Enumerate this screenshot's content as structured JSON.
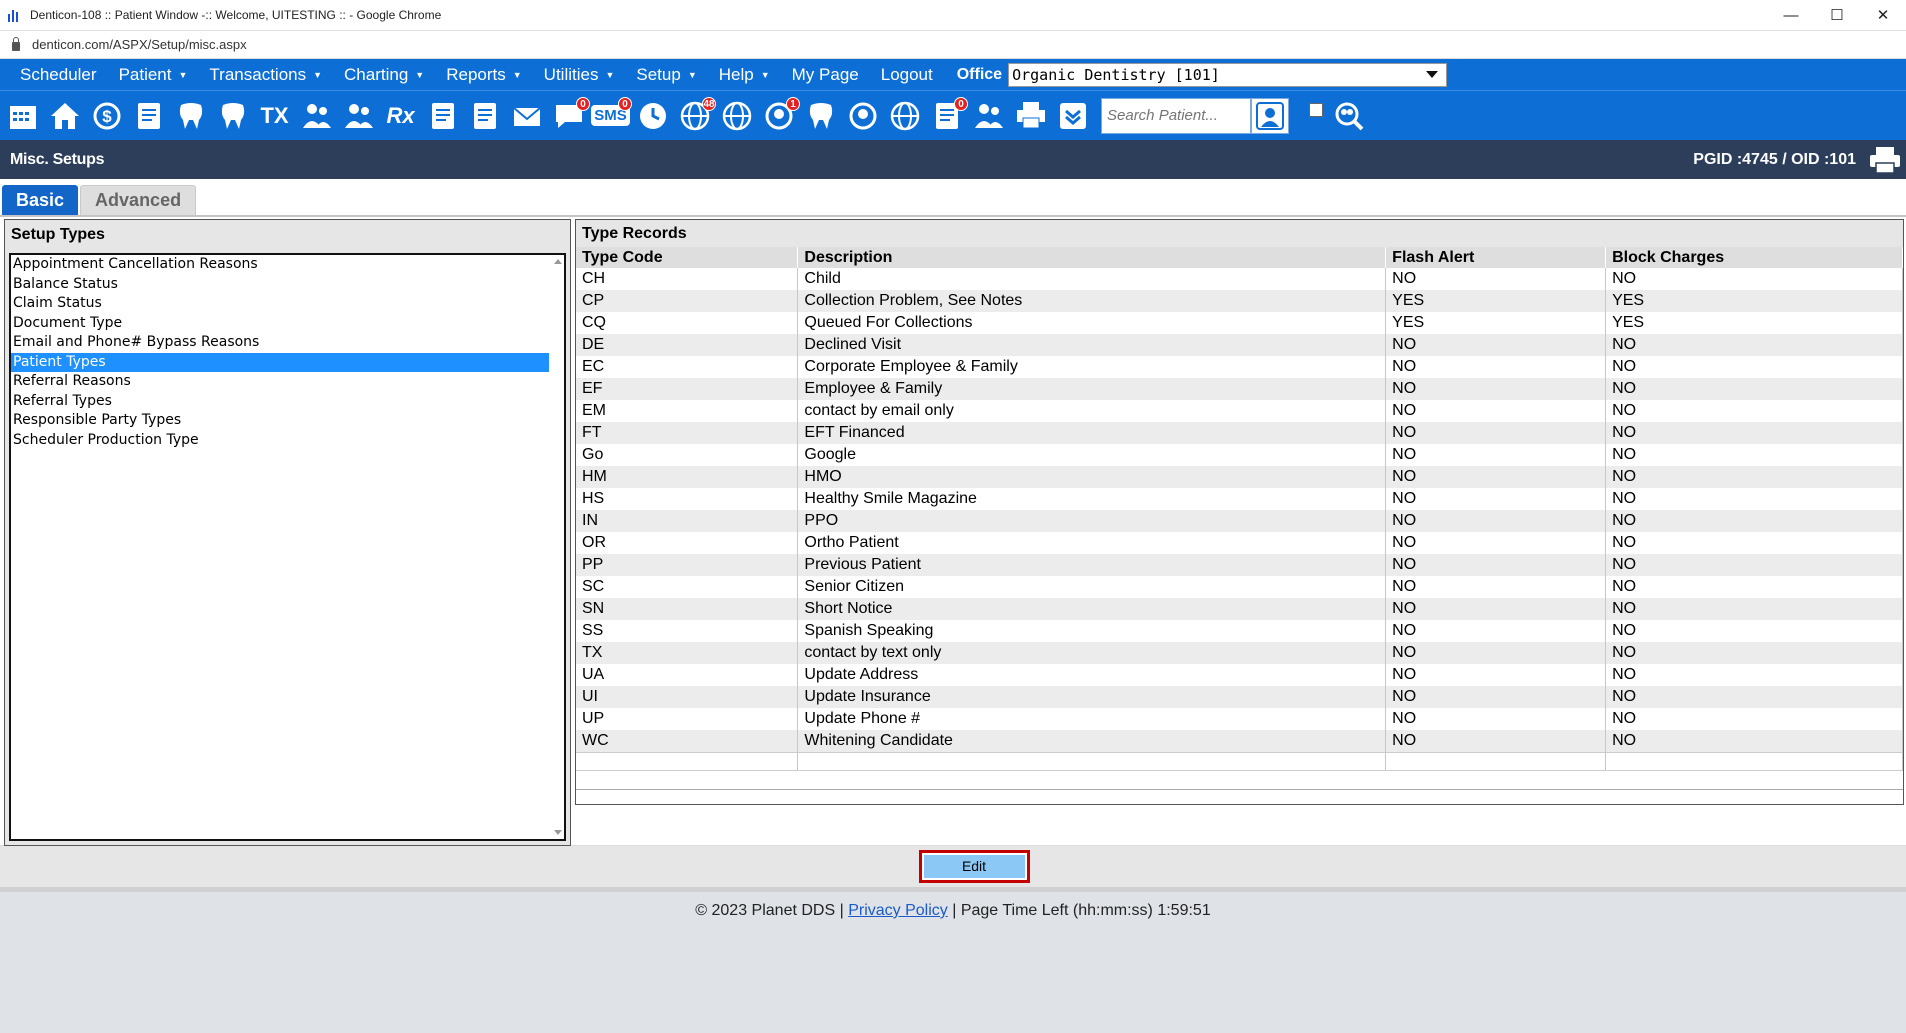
{
  "window": {
    "title": "Denticon-108 :: Patient Window -:: Welcome, UITESTING :: - Google Chrome"
  },
  "address": {
    "url": "denticon.com/ASPX/Setup/misc.aspx"
  },
  "menu": {
    "items": [
      {
        "label": "Scheduler",
        "caret": false
      },
      {
        "label": "Patient",
        "caret": true
      },
      {
        "label": "Transactions",
        "caret": true
      },
      {
        "label": "Charting",
        "caret": true
      },
      {
        "label": "Reports",
        "caret": true
      },
      {
        "label": "Utilities",
        "caret": true
      },
      {
        "label": "Setup",
        "caret": true
      },
      {
        "label": "Help",
        "caret": true
      },
      {
        "label": "My Page",
        "caret": false
      },
      {
        "label": "Logout",
        "caret": false
      }
    ],
    "office_label": "Office",
    "office_value": "Organic Dentistry [101]"
  },
  "toolbar": {
    "icons": [
      {
        "name": "calendar-icon"
      },
      {
        "name": "home-icon"
      },
      {
        "name": "dollar-sync-icon"
      },
      {
        "name": "pencil-chart-icon"
      },
      {
        "name": "tooth-chart-icon"
      },
      {
        "name": "tooth-implant-icon"
      },
      {
        "name": "treatment-icon",
        "text": "TX"
      },
      {
        "name": "add-patient-icon"
      },
      {
        "name": "family-add-icon"
      },
      {
        "name": "prescription-icon",
        "text": "Rx"
      },
      {
        "name": "notes-icon"
      },
      {
        "name": "document-icon"
      },
      {
        "name": "mail-icon"
      },
      {
        "name": "messages-icon",
        "badge": "0"
      },
      {
        "name": "sms-icon",
        "text": "SMS",
        "badge": "0"
      },
      {
        "name": "clock-icon"
      },
      {
        "name": "web-users-icon",
        "badge": "48"
      },
      {
        "name": "globe-users-icon"
      },
      {
        "name": "support-icon",
        "badge": "1"
      },
      {
        "name": "tooth-icon"
      },
      {
        "name": "tooth-help-icon"
      },
      {
        "name": "globe-network-icon"
      },
      {
        "name": "checklist-icon",
        "badge": "0"
      },
      {
        "name": "team-icon"
      },
      {
        "name": "printer-icon"
      },
      {
        "name": "download-icon"
      }
    ],
    "search_placeholder": "Search Patient..."
  },
  "header": {
    "title": "Misc. Setups",
    "pgid": "PGID :4745  /  OID :101"
  },
  "tabs": [
    {
      "label": "Basic",
      "active": true
    },
    {
      "label": "Advanced",
      "active": false
    }
  ],
  "setup_types": {
    "title": "Setup Types",
    "items": [
      "Appointment Cancellation Reasons",
      "Balance Status",
      "Claim Status",
      "Document Type",
      "Email and Phone# Bypass Reasons",
      "Patient Types",
      "Referral Reasons",
      "Referral Types",
      "Responsible Party Types",
      "Scheduler Production Type"
    ],
    "selected": "Patient Types"
  },
  "type_records": {
    "title": "Type Records",
    "columns": [
      "Type Code",
      "Description",
      "Flash Alert",
      "Block Charges"
    ],
    "rows": [
      [
        "CH",
        "Child",
        "NO",
        "NO"
      ],
      [
        "CP",
        "Collection Problem, See Notes",
        "YES",
        "YES"
      ],
      [
        "CQ",
        "Queued For Collections",
        "YES",
        "YES"
      ],
      [
        "DE",
        "Declined Visit",
        "NO",
        "NO"
      ],
      [
        "EC",
        "Corporate Employee & Family",
        "NO",
        "NO"
      ],
      [
        "EF",
        "Employee & Family",
        "NO",
        "NO"
      ],
      [
        "EM",
        "contact by email only",
        "NO",
        "NO"
      ],
      [
        "FT",
        "EFT Financed",
        "NO",
        "NO"
      ],
      [
        "Go",
        "Google",
        "NO",
        "NO"
      ],
      [
        "HM",
        "HMO",
        "NO",
        "NO"
      ],
      [
        "HS",
        "Healthy Smile Magazine",
        "NO",
        "NO"
      ],
      [
        "IN",
        "PPO",
        "NO",
        "NO"
      ],
      [
        "OR",
        "Ortho Patient",
        "NO",
        "NO"
      ],
      [
        "PP",
        "Previous Patient",
        "NO",
        "NO"
      ],
      [
        "SC",
        "Senior Citizen",
        "NO",
        "NO"
      ],
      [
        "SN",
        "Short Notice",
        "NO",
        "NO"
      ],
      [
        "SS",
        "Spanish Speaking",
        "NO",
        "NO"
      ],
      [
        "TX",
        "contact by text only",
        "NO",
        "NO"
      ],
      [
        "UA",
        "Update Address",
        "NO",
        "NO"
      ],
      [
        "UI",
        "Update Insurance",
        "NO",
        "NO"
      ],
      [
        "UP",
        "Update Phone #",
        "NO",
        "NO"
      ],
      [
        "WC",
        "Whitening Candidate",
        "NO",
        "NO"
      ]
    ]
  },
  "actions": {
    "edit_label": "Edit"
  },
  "footer": {
    "copyright": "© 2023 Planet DDS |",
    "privacy": "Privacy Policy",
    "time_left": "|  Page Time Left (hh:mm:ss) 1:59:51"
  }
}
